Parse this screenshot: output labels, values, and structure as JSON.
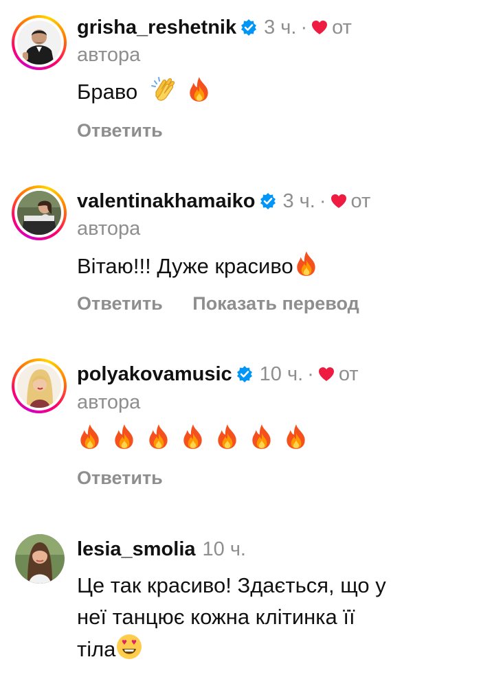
{
  "comments": [
    {
      "username": "grisha_reshetnik",
      "time": "3 ч.",
      "dot": "·",
      "liked_by": "от",
      "liked_by_2": "автора",
      "text": "Браво",
      "emojis": [
        "clapping-hands-emoji",
        "fire-emoji"
      ],
      "reply": "Ответить"
    },
    {
      "username": "valentinakhamaiko",
      "time": "3 ч.",
      "dot": "·",
      "liked_by": "от",
      "liked_by_2": "автора",
      "text": "Вітаю!!! Дуже красиво",
      "emojis": [
        "fire-emoji"
      ],
      "reply": "Ответить",
      "translate": "Показать перевод"
    },
    {
      "username": "polyakovamusic",
      "time": "10 ч.",
      "dot": "·",
      "liked_by": "от",
      "liked_by_2": "автора",
      "emojis": [
        "fire-emoji",
        "fire-emoji",
        "fire-emoji",
        "fire-emoji",
        "fire-emoji",
        "fire-emoji",
        "fire-emoji"
      ],
      "reply": "Ответить"
    },
    {
      "username": "lesia_smolia",
      "time": "10 ч.",
      "text_line1": "Це так красиво! Здається, що у",
      "text_line2": "неї танцює кожна клітинка її",
      "text_line3": "тіла",
      "emojis": [
        "heart-eyes-emoji"
      ]
    }
  ],
  "colors": {
    "verified": "#0095f6",
    "heart": "#ed1c40",
    "muted": "#8e8e8e"
  }
}
